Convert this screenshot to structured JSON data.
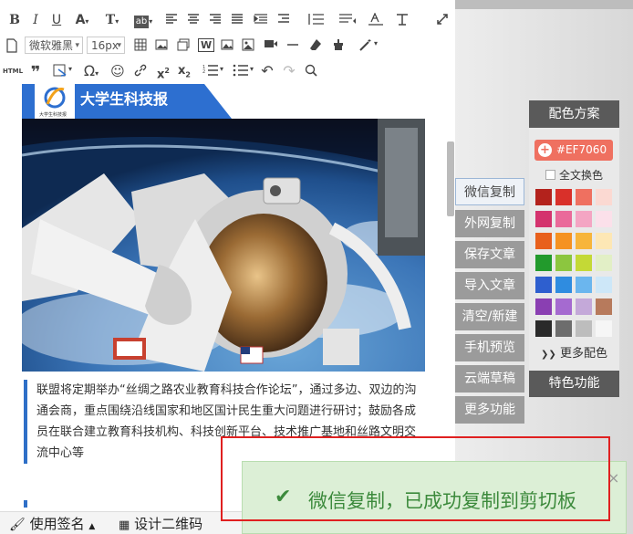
{
  "toolbar": {
    "font_family": "微软雅黑",
    "font_size": "16px",
    "html_label": "HTML"
  },
  "article": {
    "banner_title": "大学生科技报",
    "logo_caption": "大学生科技报",
    "paragraph": "联盟将定期举办“丝绸之路农业教育科技合作论坛”，通过多边、双边的沟通会商，重点围绕沿线国家和地区国计民生重大问题进行研讨；鼓励各成员在联合建立教育科技机构、科技创新平台、技术推广基地和丝路文明交流中心等"
  },
  "statusbar": {
    "signature_label": "使用签名",
    "qrcode_label": "设计二维码"
  },
  "side_tabs": [
    {
      "label": "微信复制",
      "active": true
    },
    {
      "label": "外网复制",
      "active": false
    },
    {
      "label": "保存文章",
      "active": false
    },
    {
      "label": "导入文章",
      "active": false
    },
    {
      "label": "清空/新建",
      "active": false
    },
    {
      "label": "手机预览",
      "active": false
    },
    {
      "label": "云端草稿",
      "active": false
    },
    {
      "label": "更多功能",
      "active": false
    }
  ],
  "palette": {
    "title": "配色方案",
    "current_color": "#EF7060",
    "swap_all_label": "全文换色",
    "more_colors_label": "更多配色",
    "special_label": "特色功能",
    "swatches": [
      [
        "#b3221c",
        "#d9302a",
        "#ef7060",
        "#fbd9d2"
      ],
      [
        "#d4336e",
        "#ea6a9a",
        "#f4a5c3",
        "#fbe0ea"
      ],
      [
        "#e8601c",
        "#f59222",
        "#f7b53b",
        "#fde7b5"
      ],
      [
        "#229a2c",
        "#8cc63f",
        "#c4d936",
        "#e2efc6"
      ],
      [
        "#2e5fcf",
        "#2f8ce0",
        "#6bb6ee",
        "#cde7f8"
      ],
      [
        "#8a3fb2",
        "#a56ad0",
        "#c4a9d9",
        "#b77a5c"
      ],
      [
        "#2a2a2a",
        "#6d6d6d",
        "#bdbdbd",
        "#f6f6f6"
      ]
    ]
  },
  "toast": {
    "message": "微信复制，已成功复制到剪切板",
    "close": "×"
  }
}
